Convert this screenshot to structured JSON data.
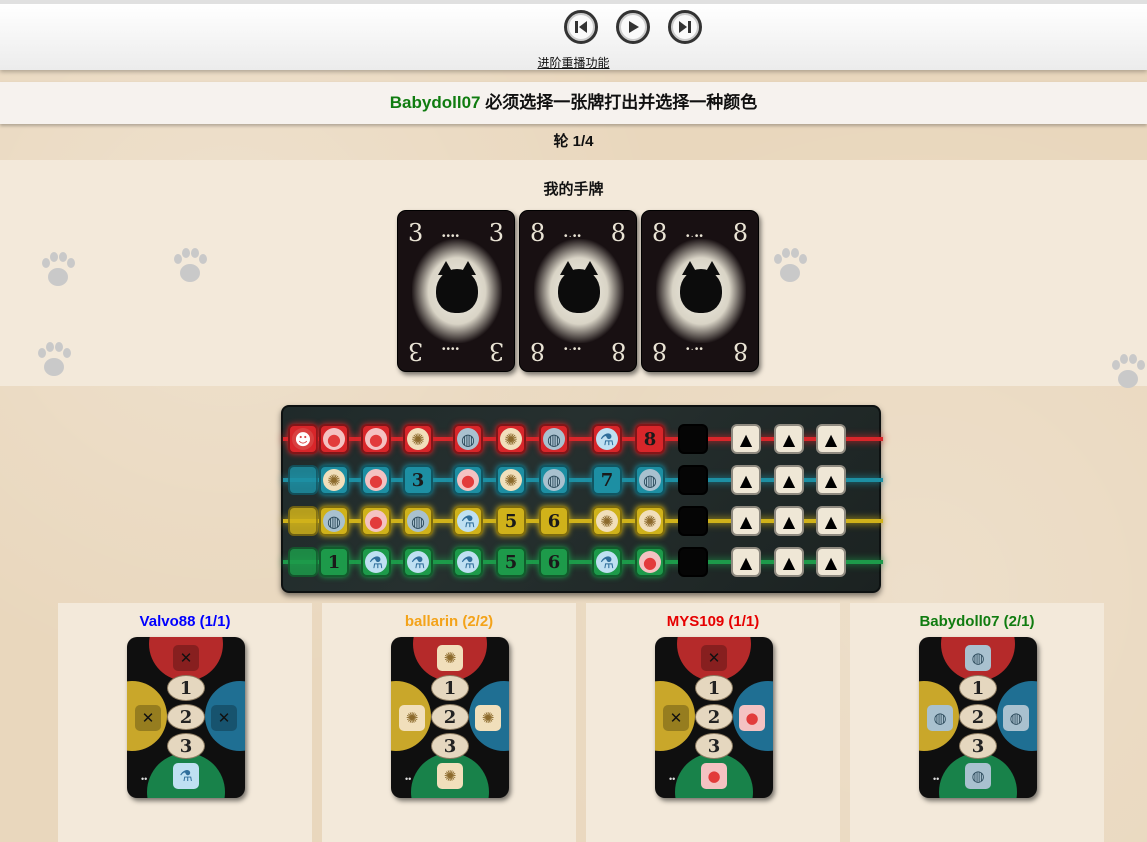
{
  "replay": {
    "link_text": "进阶重播功能",
    "buttons": [
      {
        "name": "skip-back",
        "icon": "skip-back-icon"
      },
      {
        "name": "play",
        "icon": "play-icon"
      },
      {
        "name": "skip-forward",
        "icon": "skip-forward-icon"
      }
    ]
  },
  "status": {
    "player": "Babydoll07",
    "player_color": "#107c10",
    "message": " 必须选择一张牌打出并选择一种颜色"
  },
  "round_label": "轮 1/4",
  "hand": {
    "title": "我的手牌",
    "cards": [
      {
        "value": "3",
        "pips": "••••"
      },
      {
        "value": "8",
        "pips": "•·••"
      },
      {
        "value": "8",
        "pips": "•·••"
      }
    ]
  },
  "board": {
    "rows": [
      {
        "color": "#d8262a",
        "glow": "red",
        "cells": [
          "cat-token-icon",
          "bomb-icon",
          "bomb-icon",
          "atom-icon",
          "planet-icon",
          "atom-icon",
          "planet-icon",
          "flask-icon",
          "8",
          "black-cat",
          "white-cat",
          "white-cat",
          "white-cat"
        ]
      },
      {
        "color": "#1d8fa3",
        "glow": "blue",
        "cells": [
          "empty",
          "atom-icon",
          "bomb-icon",
          "3",
          "bomb-icon",
          "atom-icon",
          "planet-icon",
          "7",
          "planet-icon",
          "black-cat",
          "white-cat",
          "white-cat",
          "white-cat"
        ]
      },
      {
        "color": "#d0b21a",
        "glow": "yellow",
        "cells": [
          "empty",
          "planet-icon",
          "bomb-icon",
          "planet-icon",
          "flask-icon",
          "5",
          "6",
          "atom-icon",
          "atom-icon",
          "black-cat",
          "white-cat",
          "white-cat",
          "white-cat"
        ]
      },
      {
        "color": "#1d9a4a",
        "glow": "green",
        "cells": [
          "empty",
          "1",
          "flask-icon",
          "flask-icon",
          "flask-icon",
          "5",
          "6",
          "flask-icon",
          "bomb-icon",
          "black-cat",
          "white-cat",
          "white-cat",
          "white-cat"
        ]
      }
    ]
  },
  "players": [
    {
      "name": "Valvo88",
      "score": "(1/1)",
      "color": "#0000ff",
      "top": "x-icon",
      "left": "x-icon",
      "right": "x-icon",
      "bottom": "flask-icon",
      "eggs": [
        "1",
        "2",
        "3"
      ]
    },
    {
      "name": "ballarin",
      "score": "(2/2)",
      "color": "#f3a31a",
      "top": "atom-icon",
      "left": "atom-icon",
      "right": "atom-icon",
      "bottom": "atom-icon",
      "eggs": [
        "1",
        "2",
        "3"
      ]
    },
    {
      "name": "MYS109",
      "score": "(1/1)",
      "color": "#e60000",
      "top": "x-icon",
      "left": "x-icon",
      "right": "bomb-icon",
      "bottom": "bomb-icon",
      "eggs": [
        "1",
        "2",
        "3"
      ]
    },
    {
      "name": "Babydoll07",
      "score": "(2/1)",
      "color": "#107c10",
      "top": "planet-icon",
      "left": "planet-icon",
      "right": "planet-icon",
      "bottom": "planet-icon",
      "eggs": [
        "1",
        "2",
        "3"
      ]
    }
  ]
}
